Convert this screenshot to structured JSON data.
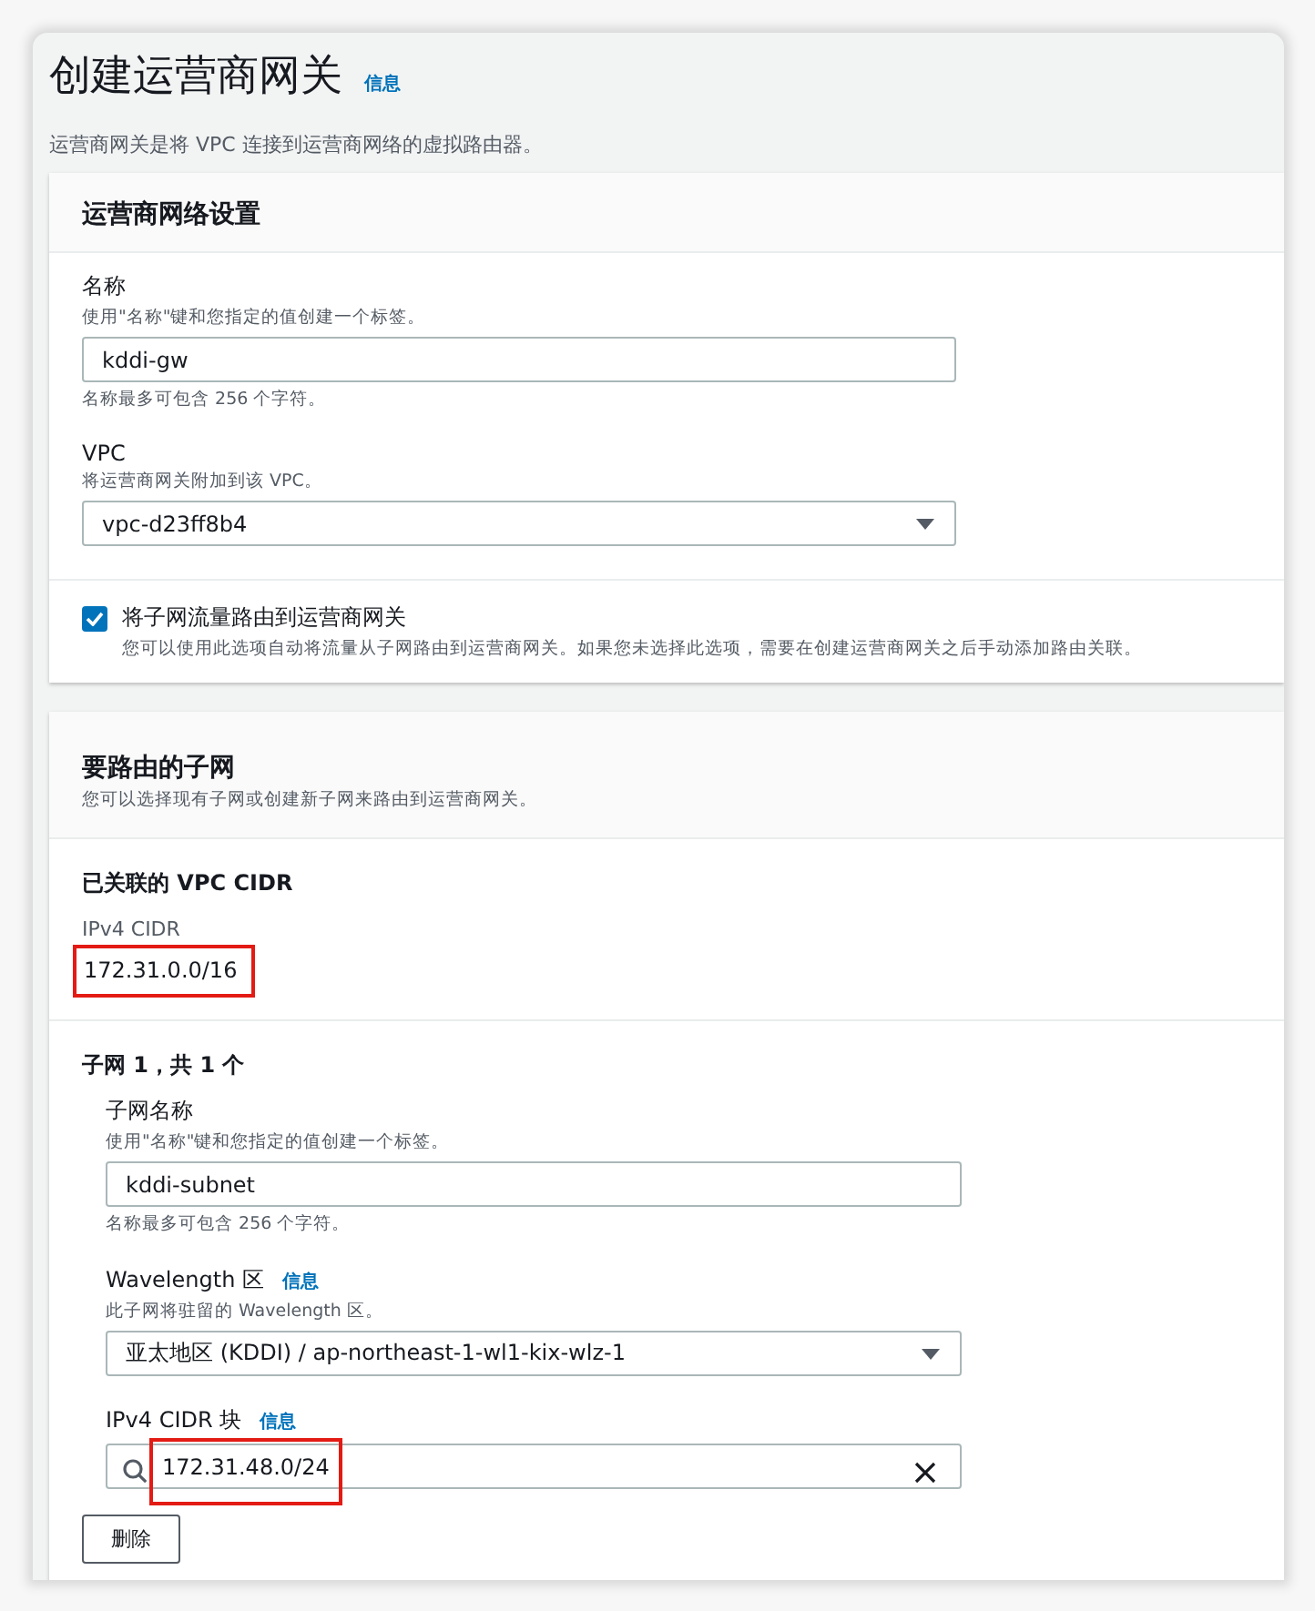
{
  "page": {
    "title": "创建运营商网关",
    "info_link": "信息",
    "description": "运营商网关是将 VPC 连接到运营商网络的虚拟路由器。"
  },
  "settings": {
    "heading": "运营商网络设置",
    "fields": [
      {
        "kind": "text",
        "label": "名称",
        "hint": "使用\"名称\"键和您指定的值创建一个标签。",
        "value": "kddi-gw",
        "constraint": "名称最多可包含 256 个字符。"
      },
      {
        "kind": "select",
        "label": "VPC",
        "hint": "将运营商网关附加到该 VPC。",
        "value": "vpc-d23ff8b4"
      }
    ],
    "route_option": {
      "checked": true,
      "label": "将子网流量路由到运营商网关",
      "description": "您可以使用此选项自动将流量从子网路由到运营商网关。如果您未选择此选项，需要在创建运营商网关之后手动添加路由关联。"
    }
  },
  "subnets": {
    "heading": "要路由的子网",
    "description": "您可以选择现有子网或创建新子网来路由到运营商网关。",
    "associated": {
      "heading": "已关联的 VPC CIDR",
      "label": "IPv4 CIDR",
      "value": "172.31.0.0/16",
      "highlighted": true
    },
    "subnet": {
      "heading": "子网 1，共 1 个",
      "fields": [
        {
          "kind": "text",
          "label": "子网名称",
          "hint": "使用\"名称\"键和您指定的值创建一个标签。",
          "value": "kddi-subnet",
          "constraint": "名称最多可包含 256 个字符。"
        },
        {
          "kind": "select",
          "label": "Wavelength 区",
          "info_link": "信息",
          "hint": "此子网将驻留的 Wavelength 区。",
          "value": "亚太地区 (KDDI) / ap-northeast-1-wl1-kix-wlz-1"
        },
        {
          "kind": "search",
          "label": "IPv4 CIDR 块",
          "info_link": "信息",
          "value": "172.31.48.0/24",
          "highlighted": true
        }
      ],
      "remove_button": "删除"
    }
  }
}
